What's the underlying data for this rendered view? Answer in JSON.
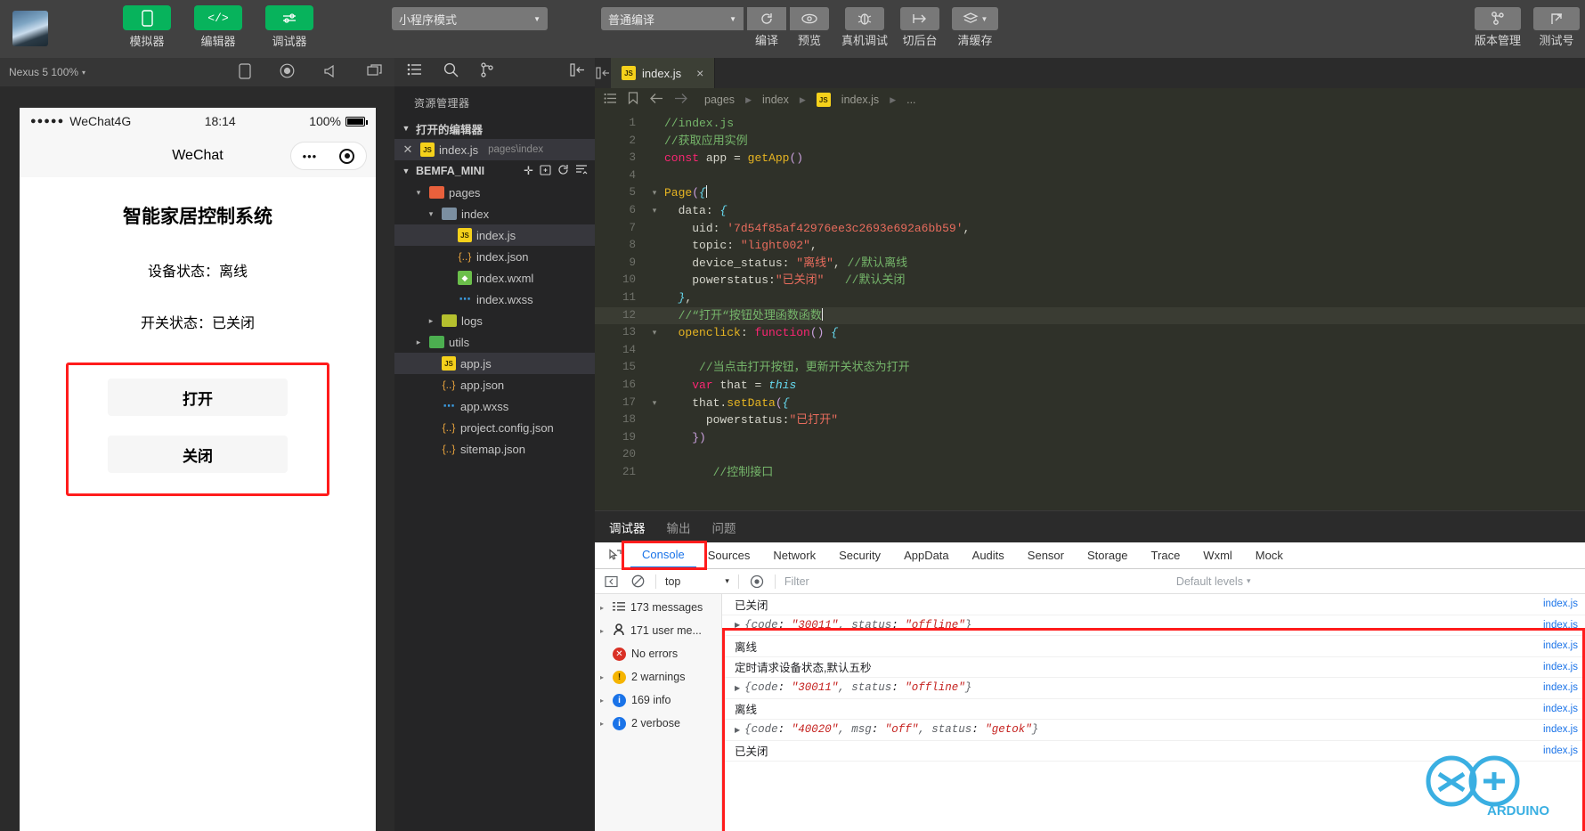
{
  "toolbar": {
    "avatar_name": "user-avatar",
    "buttons": [
      {
        "label": "模拟器",
        "icon": "phone-icon"
      },
      {
        "label": "编辑器",
        "icon": "code-icon"
      },
      {
        "label": "调试器",
        "icon": "sliders-icon"
      }
    ],
    "mode_select": "小程序模式",
    "compile_select": "普通编译",
    "actions": [
      {
        "label": "编译",
        "icon": "refresh-icon"
      },
      {
        "label": "预览",
        "icon": "eye-icon"
      },
      {
        "label": "真机调试",
        "icon": "bug-icon"
      },
      {
        "label": "切后台",
        "icon": "background-icon"
      },
      {
        "label": "清缓存",
        "icon": "layers-icon"
      }
    ],
    "right_actions": [
      {
        "label": "版本管理",
        "icon": "branch-icon"
      },
      {
        "label": "测试号",
        "icon": "external-link-icon"
      }
    ]
  },
  "simulator": {
    "device": "Nexus 5 100%",
    "device_caret": "▾",
    "icons": [
      "phone-rotate-icon",
      "record-icon",
      "megaphone-icon"
    ],
    "status_bar": {
      "signal_dots": "●●●●●",
      "carrier": "WeChat4G",
      "time": "18:14",
      "battery_text": "100%"
    },
    "nav_title": "WeChat",
    "capsule": {
      "dots": "•••",
      "target": "target-icon"
    },
    "page": {
      "title": "智能家居控制系统",
      "device_status_label": "设备状态：",
      "device_status_value": "离线",
      "switch_status_label": "开关状态：",
      "switch_status_value": "已关闭",
      "buttons": [
        "打开",
        "关闭"
      ]
    },
    "highlight_color": "#ff1c1c"
  },
  "explorer": {
    "icons": [
      "files-icon",
      "search-icon",
      "source-control-icon",
      "collapse-sidebar-icon"
    ],
    "title": "资源管理器",
    "open_editors": {
      "label": "打开的编辑器",
      "items": [
        {
          "name": "index.js",
          "path": "pages\\index",
          "icon": "js-icon"
        }
      ]
    },
    "project": {
      "name": "BEMFA_MINI",
      "actions": [
        "new-file-icon",
        "new-folder-icon",
        "refresh-icon",
        "collapse-all-icon"
      ]
    },
    "tree": [
      {
        "name": "pages",
        "type": "folder",
        "indent": 1,
        "twisty": "▾",
        "icon": "folder-pages-icon",
        "selected": false
      },
      {
        "name": "index",
        "type": "folder",
        "indent": 2,
        "twisty": "▾",
        "icon": "folder-icon",
        "selected": false
      },
      {
        "name": "index.js",
        "type": "js",
        "indent": 3,
        "twisty": "",
        "icon": "js-icon",
        "selected": true
      },
      {
        "name": "index.json",
        "type": "json",
        "indent": 3,
        "twisty": "",
        "icon": "json-icon",
        "selected": false
      },
      {
        "name": "index.wxml",
        "type": "wxml",
        "indent": 3,
        "twisty": "",
        "icon": "wxml-icon",
        "selected": false
      },
      {
        "name": "index.wxss",
        "type": "wxss",
        "indent": 3,
        "twisty": "",
        "icon": "wxss-icon",
        "selected": false
      },
      {
        "name": "logs",
        "type": "folder",
        "indent": 2,
        "twisty": "▸",
        "icon": "folder-logs-icon",
        "selected": false
      },
      {
        "name": "utils",
        "type": "folder",
        "indent": 1,
        "twisty": "▸",
        "icon": "folder-utils-icon",
        "selected": false
      },
      {
        "name": "app.js",
        "type": "js",
        "indent": 2,
        "twisty": "",
        "icon": "js-icon",
        "selected": true
      },
      {
        "name": "app.json",
        "type": "json",
        "indent": 2,
        "twisty": "",
        "icon": "json-icon",
        "selected": false
      },
      {
        "name": "app.wxss",
        "type": "wxss",
        "indent": 2,
        "twisty": "",
        "icon": "wxss-icon",
        "selected": false
      },
      {
        "name": "project.config.json",
        "type": "json",
        "indent": 2,
        "twisty": "",
        "icon": "json-icon",
        "selected": false
      },
      {
        "name": "sitemap.json",
        "type": "json",
        "indent": 2,
        "twisty": "",
        "icon": "json-icon",
        "selected": false
      }
    ]
  },
  "editor": {
    "tab": {
      "label": "index.js",
      "icon": "js-icon",
      "close": "×"
    },
    "breadcrumb": [
      "pages",
      "index",
      "index.js",
      "..."
    ],
    "breadcrumb_icons": [
      "outline-icon",
      "bookmark-icon",
      "back-arrow-icon",
      "forward-arrow-icon"
    ],
    "code_lines": [
      {
        "n": 1,
        "fold": "",
        "current": false,
        "html": "<span class='cmt'>//index.js</span>"
      },
      {
        "n": 2,
        "fold": "",
        "current": false,
        "html": "<span class='cmt'>//获取应用实例</span>"
      },
      {
        "n": 3,
        "fold": "",
        "current": false,
        "html": "<span class='kw'>const</span> <span class='pl'>app</span> <span class='pl'>=</span> <span class='fn'>getApp</span><span class='pn'>()</span>"
      },
      {
        "n": 4,
        "fold": "",
        "current": false,
        "html": ""
      },
      {
        "n": 5,
        "fold": "▾",
        "current": false,
        "html": "<span class='fn'>Page</span><span class='pn'>(</span><span class='kw2'>{</span><span class='caret-i'></span>"
      },
      {
        "n": 6,
        "fold": "▾",
        "current": false,
        "html": "  <span class='pl'>data</span><span class='pl'>:</span> <span class='kw2'>{</span>"
      },
      {
        "n": 7,
        "fold": "",
        "current": false,
        "html": "    <span class='pl'>uid</span><span class='pl'>:</span> <span class='str'>'7d54f85af42976ee3c2693e692a6bb59'</span><span class='pl'>,</span>"
      },
      {
        "n": 8,
        "fold": "",
        "current": false,
        "html": "    <span class='pl'>topic</span><span class='pl'>:</span> <span class='str'>\"light002\"</span><span class='pl'>,</span>"
      },
      {
        "n": 9,
        "fold": "",
        "current": false,
        "html": "    <span class='pl'>device_status</span><span class='pl'>:</span> <span class='str'>\"离线\"</span><span class='pl'>,</span> <span class='cmt'>//默认离线</span>"
      },
      {
        "n": 10,
        "fold": "",
        "current": false,
        "html": "    <span class='pl'>powerstatus</span><span class='pl'>:</span><span class='str'>\"已关闭\"</span>   <span class='cmt'>//默认关闭</span>"
      },
      {
        "n": 11,
        "fold": "",
        "current": false,
        "html": "  <span class='kw2'>}</span><span class='pl'>,</span>"
      },
      {
        "n": 12,
        "fold": "",
        "current": true,
        "html": "  <span class='cmt'>//“打开“按钮处理函数函数</span><span class='caret-i'></span>"
      },
      {
        "n": 13,
        "fold": "▾",
        "current": false,
        "html": "  <span class='fn'>openclick</span><span class='pl'>:</span> <span class='kw'>function</span><span class='pn'>()</span> <span class='kw2'>{</span>"
      },
      {
        "n": 14,
        "fold": "",
        "current": false,
        "html": ""
      },
      {
        "n": 15,
        "fold": "",
        "current": false,
        "html": "     <span class='cmt'>//当点击打开按钮，更新开关状态为打开</span>"
      },
      {
        "n": 16,
        "fold": "",
        "current": false,
        "html": "    <span class='kw'>var</span> <span class='pl'>that</span> <span class='pl'>=</span> <span class='kw2'>this</span>"
      },
      {
        "n": 17,
        "fold": "▾",
        "current": false,
        "html": "    <span class='pl'>that.</span><span class='fn'>setData</span><span class='pn'>(</span><span class='kw2'>{</span>"
      },
      {
        "n": 18,
        "fold": "",
        "current": false,
        "html": "      <span class='pl'>powerstatus</span><span class='pl'>:</span><span class='str'>\"已打开\"</span>"
      },
      {
        "n": 19,
        "fold": "",
        "current": false,
        "html": "    <span class='pn'>})</span>"
      },
      {
        "n": 20,
        "fold": "",
        "current": false,
        "html": ""
      },
      {
        "n": 21,
        "fold": "",
        "current": false,
        "html": "       <span class='cmt'>//控制接口</span>"
      }
    ]
  },
  "debugger": {
    "panel_tabs": [
      {
        "label": "调试器",
        "active": true
      },
      {
        "label": "输出",
        "active": false
      },
      {
        "label": "问题",
        "active": false
      }
    ],
    "devtools_tabs": [
      {
        "label": "Console",
        "active": true
      },
      {
        "label": "Sources",
        "active": false
      },
      {
        "label": "Network",
        "active": false
      },
      {
        "label": "Security",
        "active": false
      },
      {
        "label": "AppData",
        "active": false
      },
      {
        "label": "Audits",
        "active": false
      },
      {
        "label": "Sensor",
        "active": false
      },
      {
        "label": "Storage",
        "active": false
      },
      {
        "label": "Trace",
        "active": false
      },
      {
        "label": "Wxml",
        "active": false
      },
      {
        "label": "Mock",
        "active": false
      }
    ],
    "filter_bar": {
      "context": "top",
      "context_caret": "▾",
      "filter_placeholder": "Filter",
      "levels": "Default levels",
      "levels_caret": "▾",
      "icons": [
        "sidebar-toggle-icon",
        "clear-console-icon",
        "eye-icon"
      ]
    },
    "sidebar": [
      {
        "label": "173 messages",
        "twisty": "▸",
        "icon": "messages-icon"
      },
      {
        "label": "171 user me...",
        "twisty": "▸",
        "icon": "user-icon"
      },
      {
        "label": "No errors",
        "twisty": "",
        "icon": "error-icon"
      },
      {
        "label": "2 warnings",
        "twisty": "▸",
        "icon": "warning-icon"
      },
      {
        "label": "169 info",
        "twisty": "▸",
        "icon": "info-icon"
      },
      {
        "label": "2 verbose",
        "twisty": "▸",
        "icon": "verbose-icon"
      }
    ],
    "messages": [
      {
        "text": "已关闭",
        "type": "text",
        "source": "index.js"
      },
      {
        "type": "object",
        "twisty": "▸",
        "parts": [
          {
            "k": "{code",
            "sep": ": ",
            "v": "\"30011\""
          },
          {
            "k": ", status",
            "sep": ": ",
            "v": "\"offline\""
          }
        ],
        "tail": "}",
        "source": "index.js"
      },
      {
        "text": "离线",
        "type": "text",
        "source": "index.js"
      },
      {
        "text": "定时请求设备状态,默认五秒",
        "type": "text",
        "source": "index.js"
      },
      {
        "type": "object",
        "twisty": "▸",
        "parts": [
          {
            "k": "{code",
            "sep": ": ",
            "v": "\"30011\""
          },
          {
            "k": ", status",
            "sep": ": ",
            "v": "\"offline\""
          }
        ],
        "tail": "}",
        "source": "index.js"
      },
      {
        "text": "离线",
        "type": "text",
        "source": "index.js"
      },
      {
        "type": "object",
        "twisty": "▸",
        "parts": [
          {
            "k": "{code",
            "sep": ": ",
            "v": "\"40020\""
          },
          {
            "k": ", msg",
            "sep": ": ",
            "v": "\"off\""
          },
          {
            "k": ", status",
            "sep": ": ",
            "v": "\"getok\""
          }
        ],
        "tail": "}",
        "source": "index.js"
      },
      {
        "text": "已关闭",
        "type": "text",
        "source": "index.js"
      }
    ],
    "highlight_color": "#ff1c1c"
  },
  "colors": {
    "accent_green": "#07b35c",
    "devtools_blue": "#1a73e8",
    "highlight_red": "#ff1c1c",
    "editor_bg": "#2f3129",
    "sidebar_bg": "#252526",
    "toolbar_bg": "#414141"
  }
}
